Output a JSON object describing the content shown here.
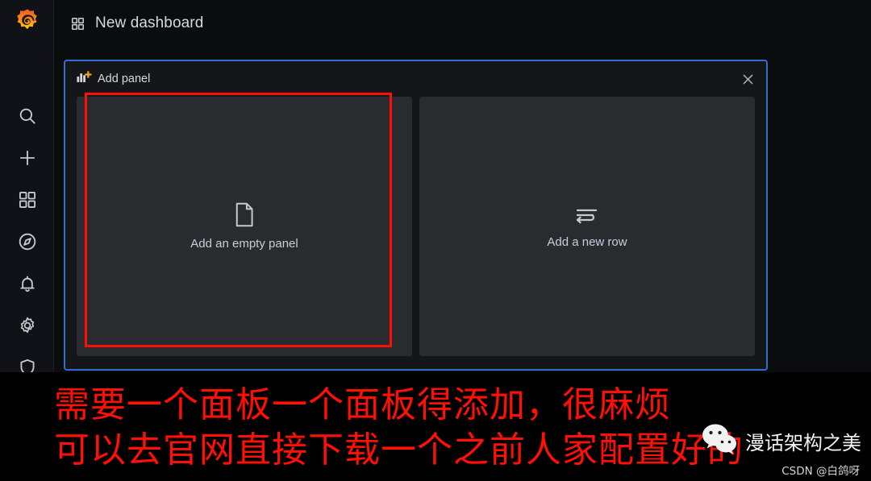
{
  "app": {
    "name": "Grafana",
    "logo_icon": "grafana-logo-icon",
    "bg_color": "#0b0c0e"
  },
  "sidebar": {
    "items": [
      {
        "icon": "search-icon",
        "label": "Search"
      },
      {
        "icon": "plus-icon",
        "label": "Create"
      },
      {
        "icon": "dashboards-icon",
        "label": "Dashboards"
      },
      {
        "icon": "compass-icon",
        "label": "Explore"
      },
      {
        "icon": "bell-icon",
        "label": "Alerting"
      },
      {
        "icon": "gear-icon",
        "label": "Configuration"
      },
      {
        "icon": "shield-icon",
        "label": "Server Admin"
      }
    ]
  },
  "breadcrumb": {
    "icon": "apps-grid-icon",
    "title": "New dashboard"
  },
  "add_panel": {
    "icon": "bar-chart-plus-icon",
    "title": "Add panel",
    "close_label": "✕",
    "accent_border_color": "#2f6fd0",
    "cards": [
      {
        "icon": "file-document-icon",
        "label": "Add an empty panel",
        "highlighted": true,
        "highlight_color": "#ff0f05"
      },
      {
        "icon": "wrap-row-icon",
        "label": "Add a new row",
        "highlighted": false
      }
    ]
  },
  "annotations": {
    "color": "#ff0f05",
    "lines": [
      "需要一个面板一个面板得添加，很麻烦",
      "可以去官网直接下载一个之前人家配置好的"
    ]
  },
  "watermark": {
    "icon": "wechat-icon",
    "name": "漫话架构之美",
    "credit": "CSDN @白鸽呀"
  }
}
